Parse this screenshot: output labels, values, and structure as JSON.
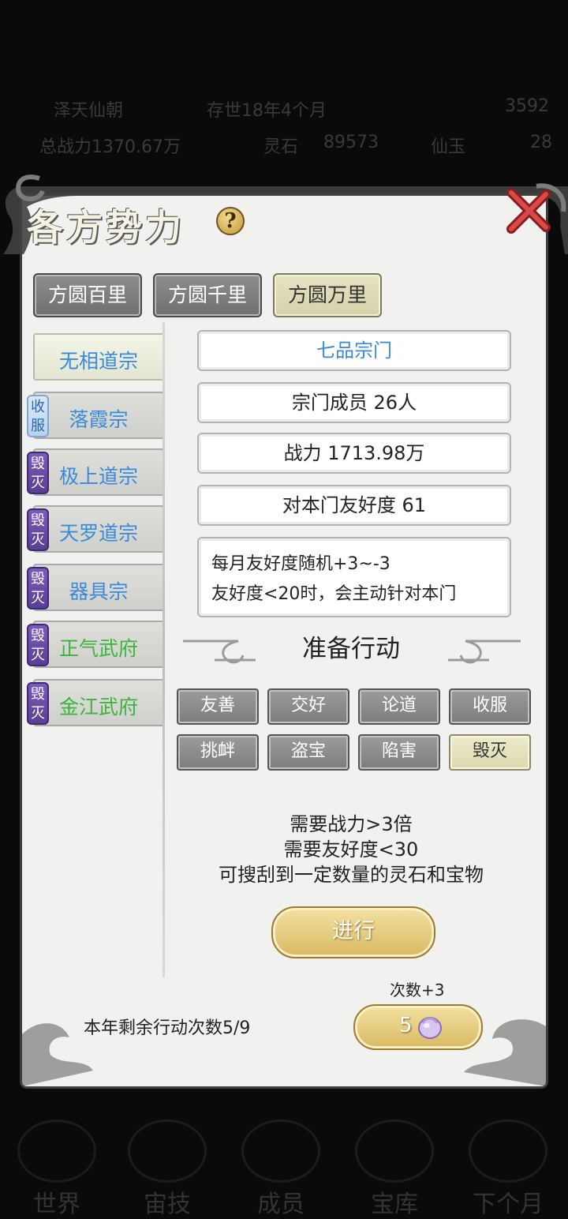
{
  "background": {
    "top_bar": {
      "dynasty": "泽天仙朝",
      "age": "存世18年4个月",
      "resource_value": "3592",
      "total_power": "总战力1370.67万",
      "spirit_stone_label": "灵石",
      "spirit_stone_value": "89573",
      "immortal_jade_label": "仙玉",
      "immortal_jade_value": "28"
    },
    "nav": [
      "世界",
      "宙技",
      "成员",
      "宝库",
      "下个月"
    ]
  },
  "panel": {
    "title": "各方势力",
    "help_symbol": "?",
    "region_tabs": [
      {
        "label": "方圆百里",
        "active": false
      },
      {
        "label": "方圆千里",
        "active": false
      },
      {
        "label": "方圆万里",
        "active": true
      }
    ],
    "sects": [
      {
        "name": "无相道宗",
        "color": "blue",
        "badge": "",
        "active": true
      },
      {
        "name": "落霞宗",
        "color": "blue",
        "badge": "收服",
        "active": false
      },
      {
        "name": "极上道宗",
        "color": "blue",
        "badge": "毁灭",
        "active": false
      },
      {
        "name": "天罗道宗",
        "color": "blue",
        "badge": "毁灭",
        "active": false
      },
      {
        "name": "器具宗",
        "color": "blue",
        "badge": "毁灭",
        "active": false
      },
      {
        "name": "正气武府",
        "color": "green",
        "badge": "毁灭",
        "active": false
      },
      {
        "name": "金江武府",
        "color": "green",
        "badge": "毁灭",
        "active": false
      }
    ],
    "selected": {
      "rank": "七品宗门",
      "members": "宗门成员 26人",
      "power": "战力 1713.98万",
      "friendship": "对本门友好度 61",
      "description": [
        "每月友好度随机+3~-3",
        "友好度<20时，会主动针对本门"
      ]
    },
    "actions_title": "准备行动",
    "actions": [
      {
        "label": "友善",
        "active": false
      },
      {
        "label": "交好",
        "active": false
      },
      {
        "label": "论道",
        "active": false
      },
      {
        "label": "收服",
        "active": false
      },
      {
        "label": "挑衅",
        "active": false
      },
      {
        "label": "盗宝",
        "active": false
      },
      {
        "label": "陷害",
        "active": false
      },
      {
        "label": "毁灭",
        "active": true
      }
    ],
    "requirements": [
      "需要战力>3倍",
      "需要友好度<30",
      "可搜刮到一定数量的灵石和宝物"
    ],
    "go_button": "进行",
    "remaining_actions": "本年剩余行动次数5/9",
    "count_bonus": "次数+3",
    "count_cost": "5",
    "colors": {
      "blue_text": "#3a8ad8",
      "green_text": "#3cb43c",
      "gold_button": "#d9b962",
      "active_tab": "#e3e0c0",
      "badge_purple": "#6a4aa8"
    }
  }
}
